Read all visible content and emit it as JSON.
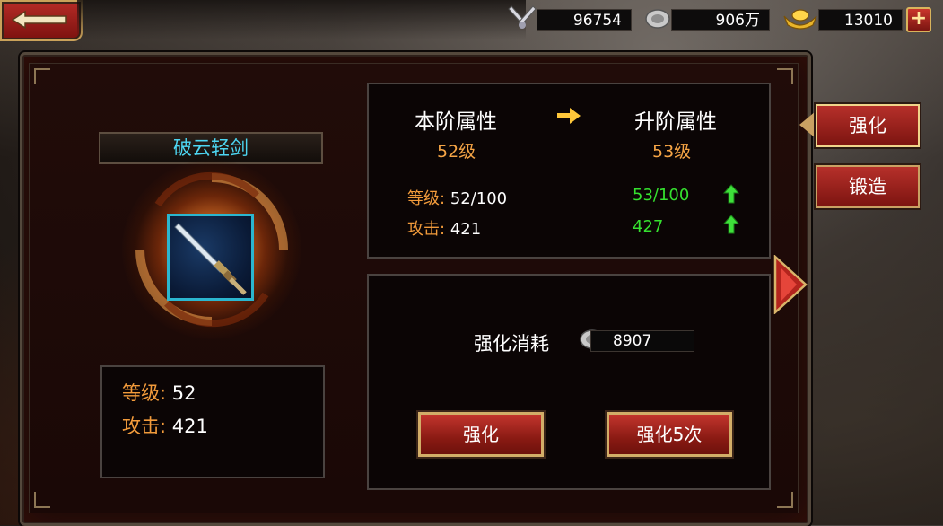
{
  "resources": {
    "combat_power": "96754",
    "silver": "906万",
    "gold": "13010",
    "add_label": "+"
  },
  "item": {
    "name": "破云轻剑",
    "level_label": "等级:",
    "level_value": "52",
    "attack_label": "攻击:",
    "attack_value": "421"
  },
  "attributes": {
    "current_header": "本阶属性",
    "next_header": "升阶属性",
    "current_level": "52级",
    "next_level": "53级",
    "current_stats": [
      {
        "label": "等级:",
        "value": "52/100"
      },
      {
        "label": "攻击:",
        "value": "421"
      }
    ],
    "next_stats": [
      "53/100",
      "427"
    ]
  },
  "enhance": {
    "cost_label": "强化消耗",
    "cost_value": "8907",
    "button_once": "强化",
    "button_five": "强化5次"
  },
  "tabs": [
    {
      "label": "强化",
      "active": true
    },
    {
      "label": "锻造",
      "active": false
    }
  ],
  "colors": {
    "accent_red": "#b6302a",
    "gold_border": "#c9a163",
    "stat_orange": "#f29b3b",
    "item_name_cyan": "#4dd6f2",
    "increase_green": "#35e02f"
  }
}
